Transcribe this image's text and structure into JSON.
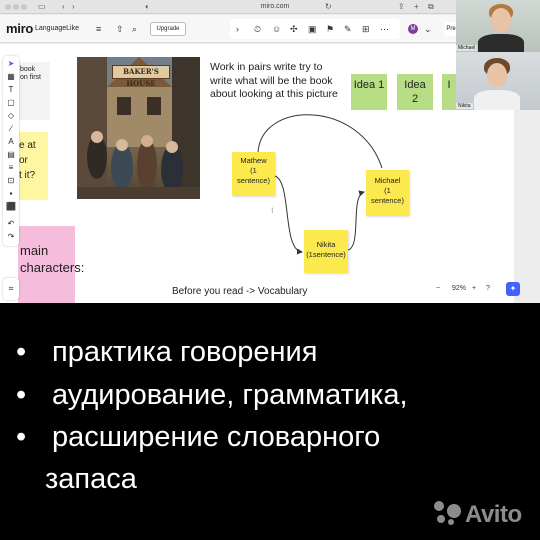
{
  "browser": {
    "url": "miro.com",
    "back_icon": "chevron-left",
    "forward_icon": "chevron-right",
    "sidebar_icon": "sidebar",
    "share_icon": "share",
    "new_tab_icon": "plus",
    "tabs_icon": "tabs"
  },
  "miro": {
    "logo": "miro",
    "board_name": "LanguageLike",
    "upgrade_label": "Upgrade",
    "menu_icon": "hamburger",
    "share_icon": "share",
    "search_icon": "search",
    "avatar_initial": "M",
    "present_label": "Pre",
    "top_tools": [
      "›",
      "⏲",
      "☺",
      "✣",
      "▣",
      "⚑",
      "✎",
      "⊞",
      "⋯"
    ]
  },
  "left_toolbar": [
    "➤",
    "▦",
    "T",
    "▢",
    "◇",
    "∕",
    "A",
    "▤",
    "≡",
    "⊡",
    "▪",
    "⬛",
    "↶",
    "↷"
  ],
  "left_toolbar_bottom": "⌗",
  "canvas": {
    "note_book_text": "book\non first",
    "note_yellow_left_text": "e at\nor\nt it?",
    "note_pink_text": "main\ncharacters:",
    "picture_sign": "BAKER'S HOUSE",
    "instruction": "Work in pairs write try to write what will be the book about looking at this picture",
    "ideas": [
      {
        "label": "Idea\n1"
      },
      {
        "label": "Idea\n2"
      },
      {
        "label": "I"
      }
    ],
    "flow_notes": {
      "mathew": "Mathew\n(1\nsentence)",
      "nikita": "Nikita\n(1sentence)",
      "michael": "Michael\n(1\nsentence)"
    },
    "caption": "Before you read -> Vocabulary"
  },
  "zoom": {
    "minus": "−",
    "level": "92%",
    "plus": "+",
    "help_icon": "?",
    "ai_icon": "✦"
  },
  "participants": [
    {
      "name": "Michael"
    },
    {
      "name": "Nikita"
    }
  ],
  "bullets": [
    {
      "dot": "•",
      "text": "практика говорения"
    },
    {
      "dot": "•",
      "text": "аудирование, грамматика,"
    },
    {
      "dot": "•",
      "text": "расширение словарного"
    }
  ],
  "bullet_continuation": "запаса",
  "watermark": {
    "text": "Avito"
  },
  "colors": {
    "sticky_yellow": "#fce94d",
    "sticky_green": "#b6dd83",
    "sticky_pink": "#f5bcdc",
    "ai_blue": "#4262ff",
    "avatar_purple": "#7a3fa0"
  }
}
